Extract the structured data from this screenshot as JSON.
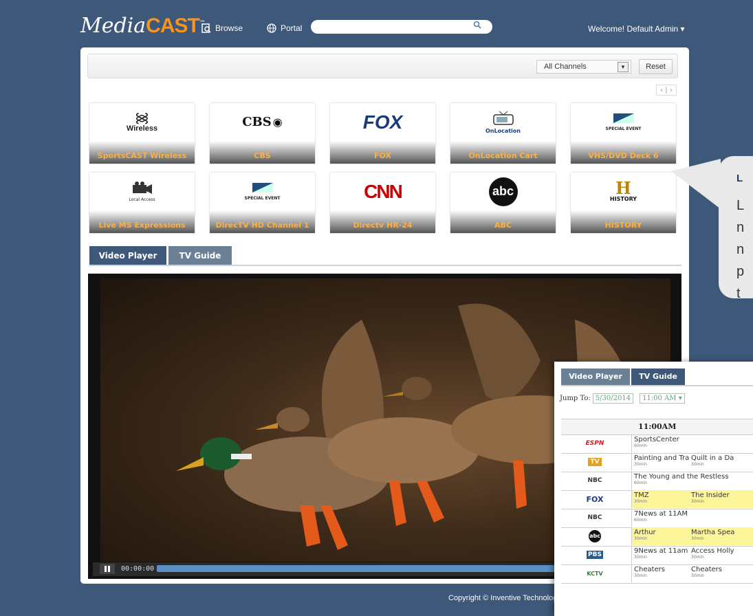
{
  "header": {
    "logo_media": "Media",
    "logo_cast": "CAST",
    "browse_label": "Browse",
    "portal_label": "Portal",
    "search_value": "",
    "welcome": "Welcome! Default Admin"
  },
  "toolbar": {
    "channel_select": "All Channels",
    "reset_label": "Reset",
    "pager": "‹ | ›"
  },
  "tiles": [
    {
      "label": "SportsCAST Wireless",
      "logo": "Wireless"
    },
    {
      "label": "CBS",
      "logo": "CBS"
    },
    {
      "label": "FOX",
      "logo": "FOX"
    },
    {
      "label": "OnLocation Cart",
      "logo": "OnLocation"
    },
    {
      "label": "VHS/DVD Deck 6",
      "logo": "SPECIAL EVENT"
    },
    {
      "label": "Live MS Expressions",
      "logo": "Local Access"
    },
    {
      "label": "DirecTV HD Channel 1",
      "logo": "SPECIAL EVENT"
    },
    {
      "label": "Directv HR-24",
      "logo": "CNN"
    },
    {
      "label": "ABC",
      "logo": "abc"
    },
    {
      "label": "HISTORY",
      "logo": "HISTORY"
    }
  ],
  "tabs": {
    "video_player": "Video Player",
    "tv_guide": "TV Guide"
  },
  "player": {
    "timecode": "00:00:00",
    "progress": 0
  },
  "copyright": "Copyright © Inventive Technology",
  "callout": {
    "title": "L",
    "lines": [
      "L",
      "n",
      "n",
      "p",
      "t"
    ]
  },
  "guide": {
    "tabs": {
      "video_player": "Video Player",
      "tv_guide": "TV Guide"
    },
    "jump_label": "Jump To:",
    "date": "5/30/2014",
    "time": "11:00 AM",
    "time_header": "11:00AM",
    "rows": [
      {
        "channel": "ESPN",
        "color": "#d71921",
        "cells": [
          {
            "title": "SportsCenter",
            "dur": "60min",
            "hl": false
          }
        ]
      },
      {
        "channel": "TV",
        "color": "#e6a01e",
        "cells": [
          {
            "title": "Painting and Travel",
            "dur": "30min",
            "hl": false
          },
          {
            "title": "Quilt in a Da",
            "dur": "30min",
            "hl": false
          }
        ]
      },
      {
        "channel": "NBC",
        "color": "#333333",
        "cells": [
          {
            "title": "The Young and the Restless",
            "dur": "60min",
            "hl": false
          }
        ]
      },
      {
        "channel": "FOX",
        "color": "#1a3b7a",
        "cells": [
          {
            "title": "TMZ",
            "dur": "30min",
            "hl": true
          },
          {
            "title": "The Insider",
            "dur": "30min",
            "hl": true
          }
        ]
      },
      {
        "channel": "NBC",
        "color": "#333333",
        "cells": [
          {
            "title": "7News at 11AM",
            "dur": "60min",
            "hl": false
          }
        ]
      },
      {
        "channel": "abc",
        "color": "#111111",
        "cells": [
          {
            "title": "Arthur",
            "dur": "30min",
            "hl": true
          },
          {
            "title": "Martha Spea",
            "dur": "30min",
            "hl": true
          }
        ]
      },
      {
        "channel": "PBS",
        "color": "#2a5a8a",
        "cells": [
          {
            "title": "9News at 11am",
            "dur": "30min",
            "hl": false
          },
          {
            "title": "Access Holly",
            "dur": "30min",
            "hl": false
          }
        ]
      },
      {
        "channel": "KCTV",
        "color": "#3a7a3a",
        "cells": [
          {
            "title": "Cheaters",
            "dur": "30min",
            "hl": false
          },
          {
            "title": "Cheaters",
            "dur": "30min",
            "hl": false
          }
        ]
      }
    ]
  },
  "colors": {
    "background": "#3e5879",
    "accent": "#f7941d",
    "tab_active": "#3e5879",
    "tab_inactive": "#6b7f95",
    "tile_label": "#fbb040"
  }
}
